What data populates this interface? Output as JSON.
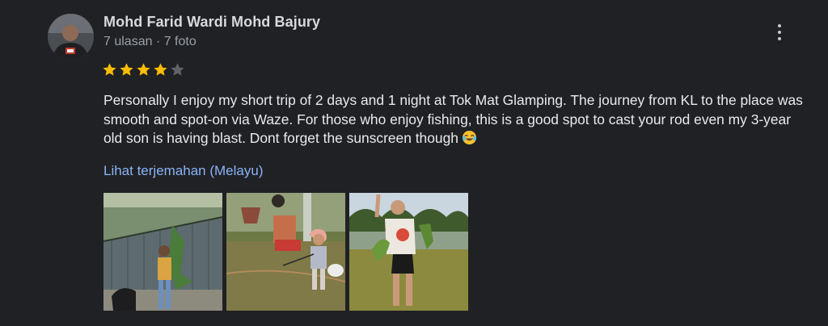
{
  "review": {
    "author": {
      "name": "Mohd Farid Wardi Mohd Bajury",
      "meta": "7 ulasan · 7 foto"
    },
    "rating": {
      "value": 4,
      "max": 5,
      "filled_color": "#fbbc04",
      "empty_color": "#5f6368"
    },
    "text": "Personally I enjoy my short trip of 2 days and 1 night at Tok Mat Glamping. The journey from KL to the place was smooth and spot-on via Waze. For those who enjoy fishing, this is a good spot to cast your rod even my 3-year old son is having blast. Dont forget the sunscreen though",
    "emoji": "face-with-tears-of-joy-icon",
    "translate_link": "Lihat terjemahan (Melayu)",
    "more_icon": "more-vert-icon",
    "photos": [
      {
        "name": "review-photo-1"
      },
      {
        "name": "review-photo-2"
      },
      {
        "name": "review-photo-3"
      }
    ]
  },
  "colors": {
    "background": "#202124",
    "text": "#e8eaed",
    "secondary_text": "#9aa0a6",
    "link": "#8ab4f8"
  }
}
